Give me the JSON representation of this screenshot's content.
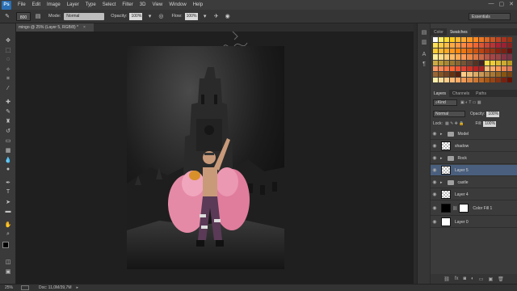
{
  "app": {
    "logo": "Ps"
  },
  "menu": [
    "File",
    "Edit",
    "Image",
    "Layer",
    "Type",
    "Select",
    "Filter",
    "3D",
    "View",
    "Window",
    "Help"
  ],
  "window_controls": [
    "—",
    "▢",
    "✕"
  ],
  "options_bar": {
    "brush_size": "800",
    "mode_label": "Mode:",
    "mode_value": "Normal",
    "opacity_label": "Opacity:",
    "opacity_value": "100%",
    "flow_label": "Flow:",
    "flow_value": "100%",
    "workspace": "Essentials"
  },
  "document_tab": {
    "title": "mingo @ 25% (Layer 5, RGB/8) *",
    "close": "×"
  },
  "status_bar": {
    "zoom": "25%",
    "doc": "Doc: 11,0M/39,7M"
  },
  "panels": {
    "top_tabs": [
      "Color",
      "Swatches"
    ],
    "swatch_colors": [
      "#ffffff",
      "#ffee66",
      "#ffdd33",
      "#ffcc22",
      "#ffbb33",
      "#ffaa33",
      "#ff9922",
      "#ff8822",
      "#ee7722",
      "#dd6622",
      "#cc5522",
      "#bb4422",
      "#aa3322",
      "#993311",
      "#ffe055",
      "#ffcc44",
      "#ffbb44",
      "#ffaa44",
      "#ff9944",
      "#ff8844",
      "#ff7733",
      "#ee6633",
      "#dd5533",
      "#cc4433",
      "#bb3333",
      "#aa2233",
      "#992233",
      "#882222",
      "#ffcc33",
      "#ffbb33",
      "#ffaa22",
      "#ff9922",
      "#ff8811",
      "#ee7711",
      "#dd6611",
      "#cc5511",
      "#bb4411",
      "#aa3311",
      "#993311",
      "#882211",
      "#772211",
      "#661111",
      "#ffee99",
      "#ffdd88",
      "#ffcc77",
      "#ffbb66",
      "#ffaa55",
      "#ff9955",
      "#ee8844",
      "#dd7744",
      "#cc6644",
      "#bb5544",
      "#aa4444",
      "#994444",
      "#883344",
      "#773344",
      "#ccaa44",
      "#bb9933",
      "#aa8833",
      "#997733",
      "#886633",
      "#775533",
      "#664433",
      "#553322",
      "#442222",
      "#ffdd44",
      "#eecc33",
      "#ddbb33",
      "#ccaa33",
      "#bb9922",
      "#ff9966",
      "#ff8855",
      "#ff7744",
      "#ff6633",
      "#ee5533",
      "#dd4433",
      "#cc3322",
      "#bb2222",
      "#aa2222",
      "#ffbb77",
      "#ffaa66",
      "#ff9955",
      "#ee8855",
      "#dd7755",
      "#996633",
      "#885522",
      "#774422",
      "#663311",
      "#552211",
      "#ffcc88",
      "#eebb77",
      "#ddaa66",
      "#cc9955",
      "#bb8844",
      "#aa7733",
      "#996622",
      "#885511",
      "#774411",
      "#ffeeaa",
      "#ffdd99",
      "#ffcc88",
      "#ffbb77",
      "#ffaa66",
      "#ee9955",
      "#dd8844",
      "#cc7733",
      "#bb6622",
      "#aa5511",
      "#994411",
      "#883311",
      "#772211",
      "#661100"
    ],
    "layers_tabs": [
      "Layers",
      "Channels",
      "Paths"
    ],
    "kind_label": "Kind",
    "blend_mode": "Normal",
    "opacity_label": "Opacity:",
    "opacity_value": "100%",
    "lock_label": "Lock:",
    "fill_label": "Fill:",
    "fill_value": "100%",
    "layers": [
      {
        "name": "Model",
        "type": "group"
      },
      {
        "name": "shadow",
        "type": "pixel-check"
      },
      {
        "name": "Rock",
        "type": "group"
      },
      {
        "name": "Layer 5",
        "type": "pixel-check",
        "selected": true
      },
      {
        "name": "castle",
        "type": "group"
      },
      {
        "name": "Layer 4",
        "type": "pixel-check"
      },
      {
        "name": "Color Fill 1",
        "type": "fill"
      },
      {
        "name": "Layer 0",
        "type": "pixel-white"
      }
    ],
    "footer_icons": [
      "link-icon",
      "fx-icon",
      "mask-icon",
      "adjustment-icon",
      "folder-icon",
      "new-layer-icon",
      "trash-icon"
    ]
  }
}
